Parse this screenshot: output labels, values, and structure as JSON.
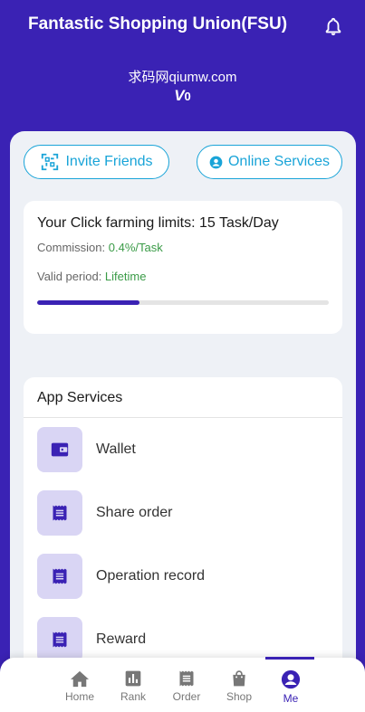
{
  "header": {
    "title": "Fantastic Shopping Union(FSU)",
    "bell_icon": "bell-icon",
    "user_name": "求码网qiumw.com",
    "vip_prefix": "V",
    "vip_level": "0"
  },
  "actions": {
    "invite_label": "Invite Friends",
    "online_label": "Online Services"
  },
  "limits": {
    "title": "Your Click farming limits: 15 Task/Day",
    "commission_label": "Commission: ",
    "commission_value": "0.4%/Task",
    "valid_label": "Valid period: ",
    "valid_value": "Lifetime",
    "progress_fraction": 0.35
  },
  "services": {
    "title": "App Services",
    "items": [
      {
        "label": "Wallet",
        "icon": "wallet-icon"
      },
      {
        "label": "Share order",
        "icon": "document-icon"
      },
      {
        "label": "Operation record",
        "icon": "document-icon"
      },
      {
        "label": "Reward",
        "icon": "document-icon"
      }
    ]
  },
  "tabbar": {
    "home": "Home",
    "rank": "Rank",
    "order": "Order",
    "shop": "Shop",
    "me": "Me"
  },
  "colors": {
    "primary": "#3a22b4",
    "accent": "#19a4d8",
    "green": "#3a9b47",
    "icon_bg": "#d9d5f4"
  }
}
